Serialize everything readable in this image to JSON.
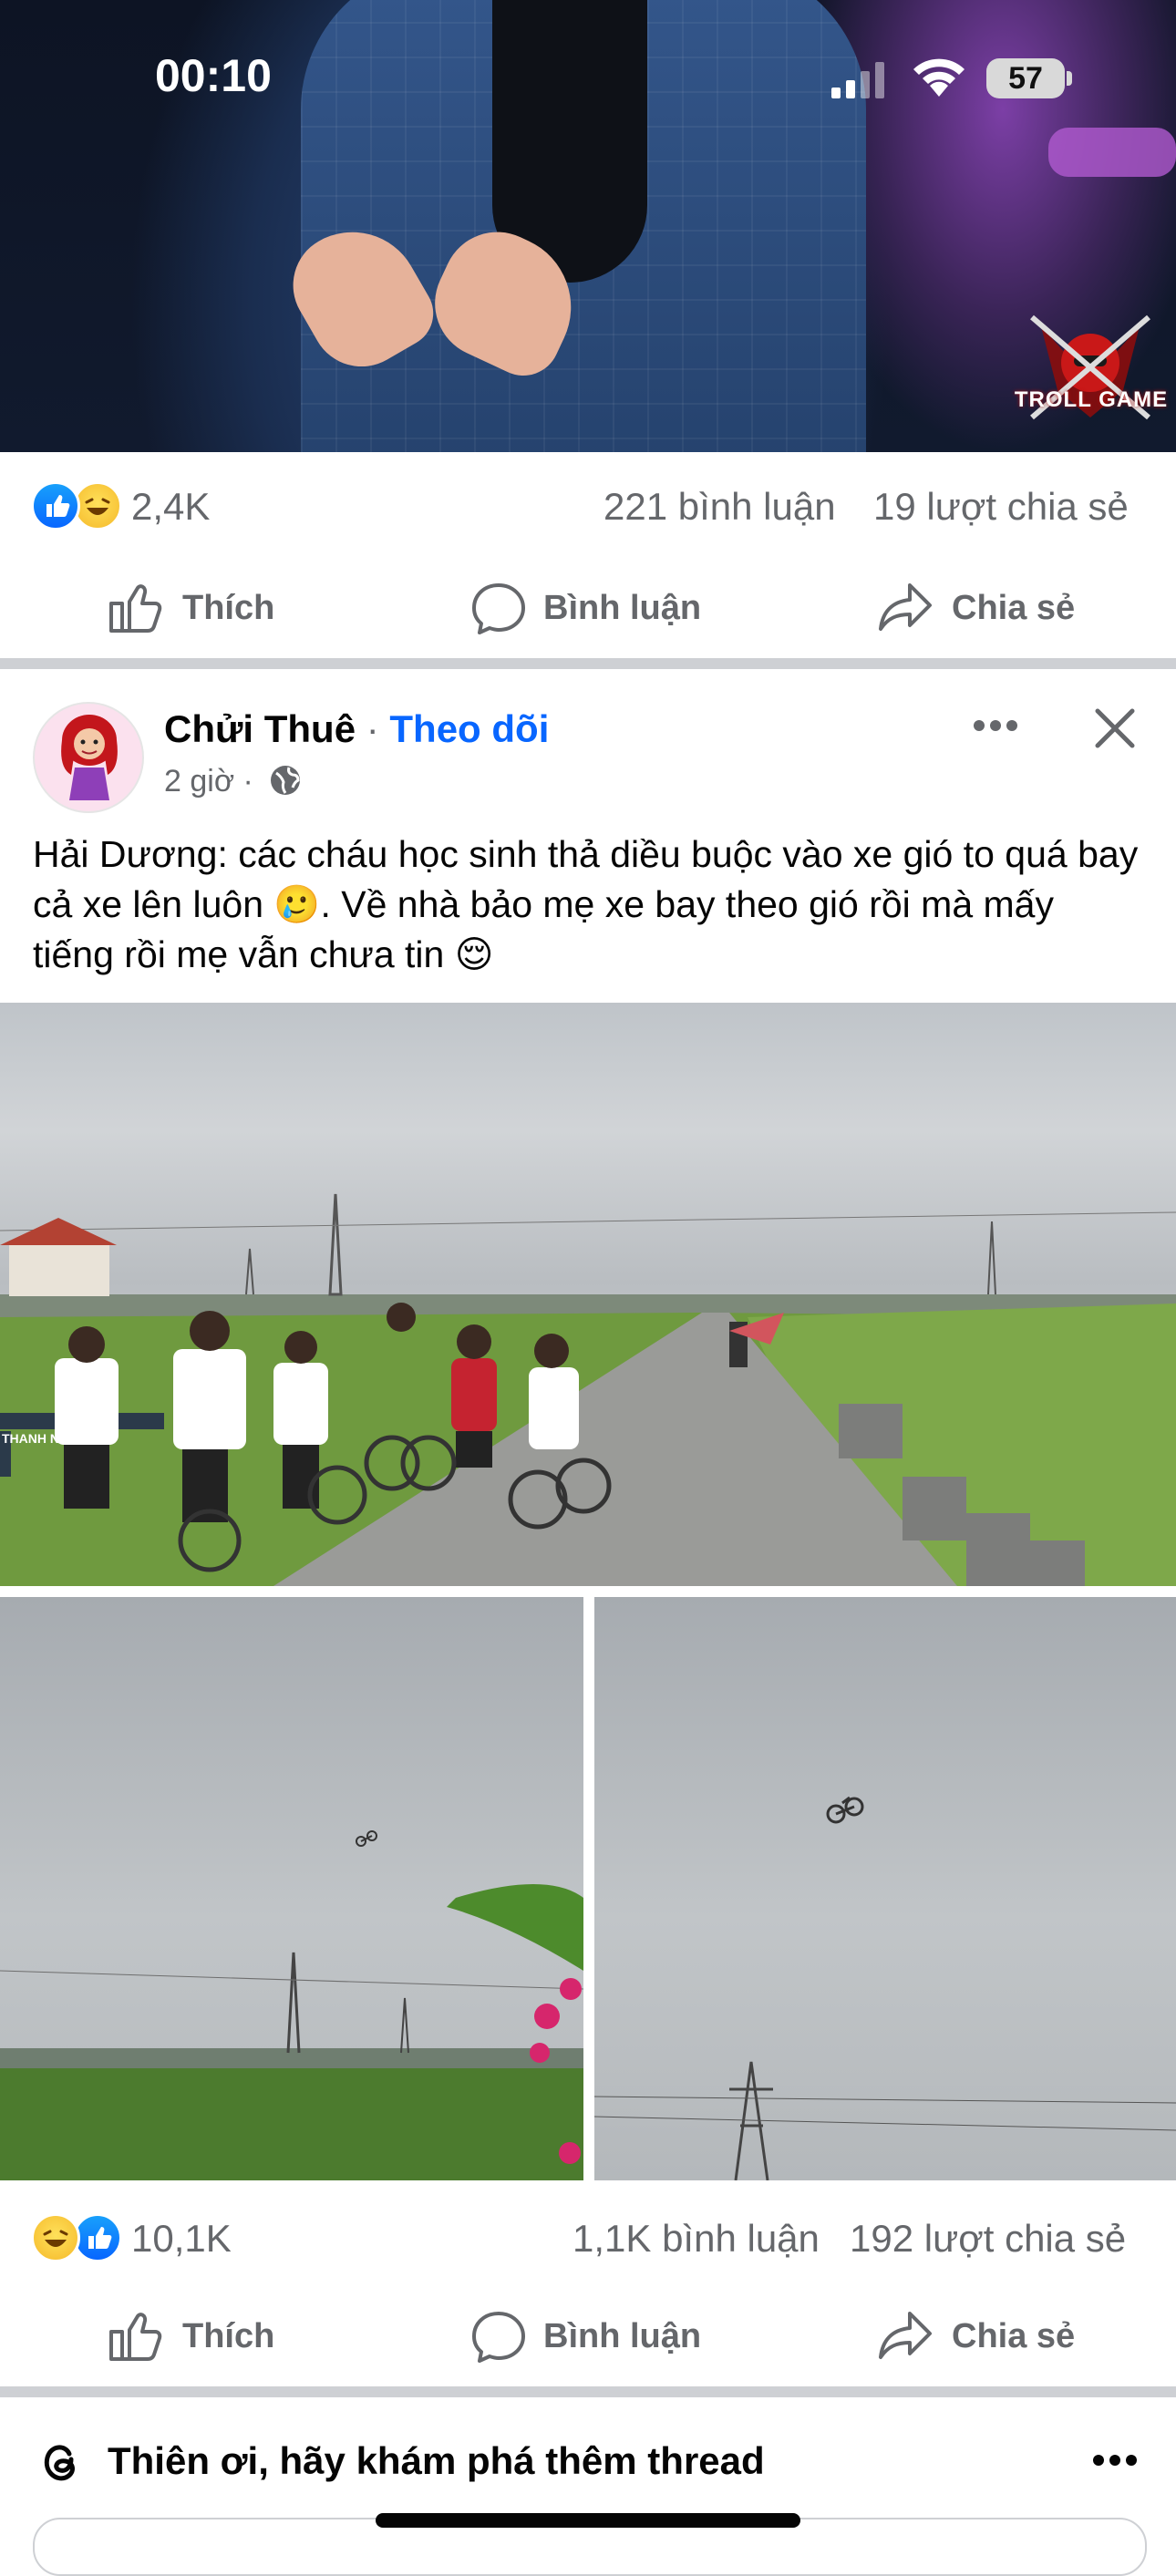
{
  "status_bar": {
    "time": "00:10",
    "battery": "57"
  },
  "top_post": {
    "reaction_count": "2,4K",
    "comments": "221 bình luận",
    "shares": "19 lượt chia sẻ",
    "watermark": "TROLL GAME"
  },
  "actions": {
    "like": "Thích",
    "comment": "Bình luận",
    "share": "Chia sẻ"
  },
  "post": {
    "author": "Chửi Thuê",
    "separator": " · ",
    "follow": "Theo dõi",
    "time": "2 giờ ·",
    "text_part1": "Hải Dương: các cháu học sinh thả diều buộc vào xe gió to quá bay cả xe lên luôn ",
    "emoji1": "🥲",
    "text_part2": ". Về nhà bảo mẹ xe bay theo gió rồi mà mấy tiếng rồi mẹ vẫn chưa tin ",
    "emoji2": "😌",
    "reaction_count": "10,1K",
    "comments": "1,1K bình luận",
    "shares": "192 lượt chia sẻ",
    "image_sign": "THANH NHÀN"
  },
  "threads": {
    "label": "Thiên ơi, hãy khám phá thêm thread"
  },
  "icons": {
    "like": "thumbs-up-icon",
    "comment": "comment-bubble-icon",
    "share": "share-arrow-icon",
    "more": "more-dots-icon",
    "close": "close-icon",
    "globe": "globe-icon",
    "threads": "threads-logo-icon"
  },
  "colors": {
    "accent": "#0866ff",
    "secondary_text": "#65676b",
    "divider": "#ced0d4"
  }
}
